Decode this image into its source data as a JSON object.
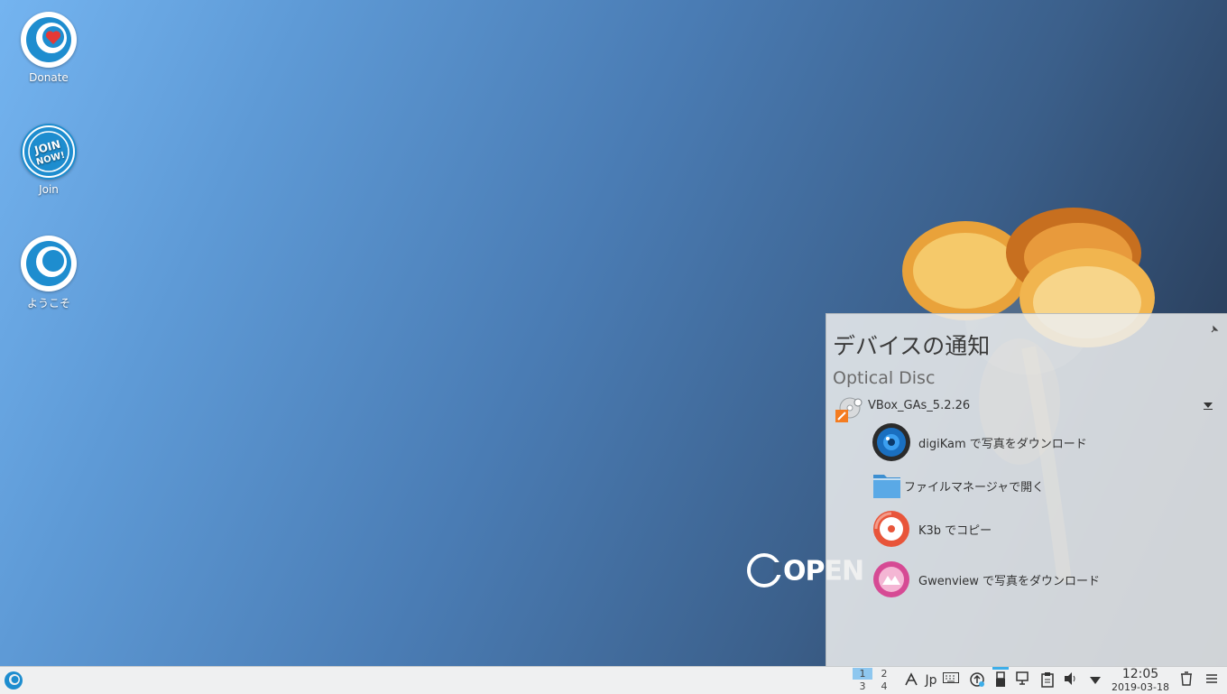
{
  "desktop": {
    "icons": [
      {
        "label": "Donate",
        "icon": "donate-heart-icon"
      },
      {
        "label": "Join",
        "icon": "join-now-icon"
      },
      {
        "label": "ようこそ",
        "icon": "opensuse-welcome-icon"
      }
    ],
    "brand_text": "OPEN"
  },
  "popup": {
    "title": "デバイスの通知",
    "category": "Optical Disc",
    "device_label": "VBox_GAs_5.2.26",
    "actions": [
      {
        "label": "digiKam で写真をダウンロード",
        "icon": "digikam-icon"
      },
      {
        "label": "ファイルマネージャで開く",
        "icon": "folder-icon"
      },
      {
        "label": "K3b でコピー",
        "icon": "k3b-icon"
      },
      {
        "label": "Gwenview で写真をダウンロード",
        "icon": "gwenview-icon"
      }
    ]
  },
  "taskbar": {
    "pager": [
      "1",
      "2",
      "3",
      "4"
    ],
    "active_desktop": "1",
    "input_method": "Jp",
    "clock_time": "12:05",
    "clock_date": "2019-03-18"
  },
  "colors": {
    "accent": "#3daee9",
    "taskbar_bg": "#eff0f1",
    "opensuse_blue": "#1e8dcf"
  }
}
